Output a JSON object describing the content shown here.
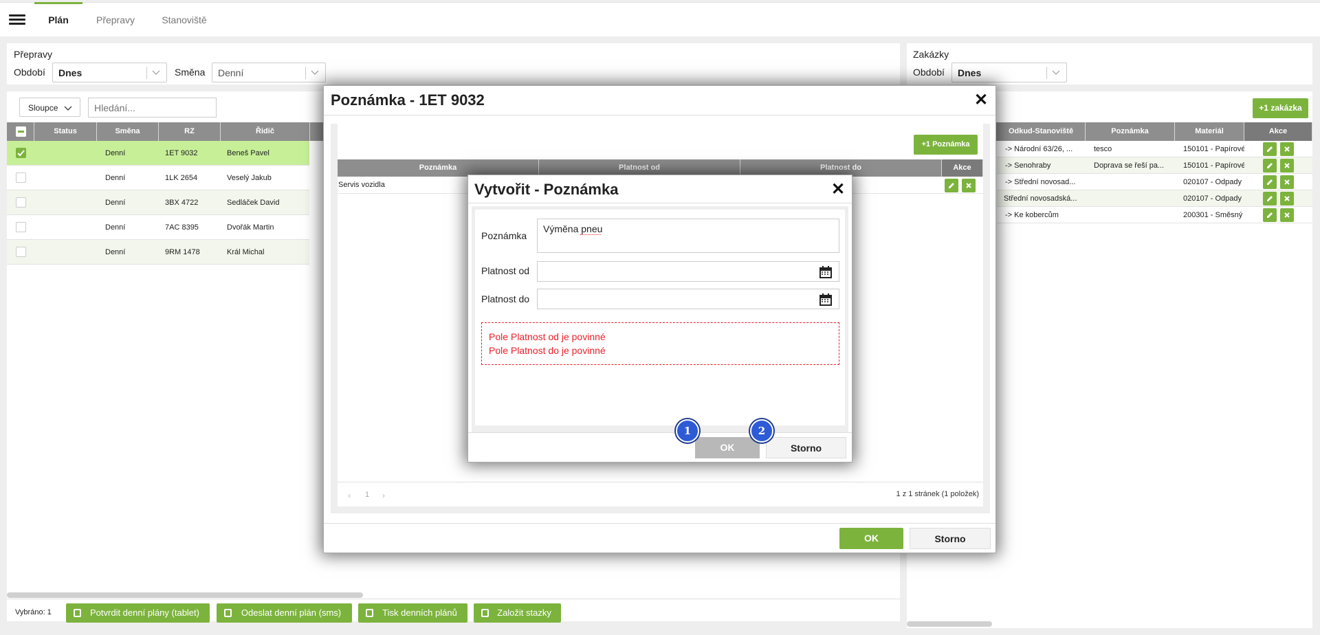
{
  "nav": {
    "tabs": [
      "Plán",
      "Přepravy",
      "Stanoviště"
    ]
  },
  "left_panel": {
    "title": "Přepravy",
    "obdobi_label": "Období",
    "obdobi_value": "Dnes",
    "smena_label": "Směna",
    "smena_value": "Denní",
    "columns_button": "Sloupce",
    "search_placeholder": "Hledání...",
    "headers": [
      "Status",
      "Směna",
      "RZ",
      "Řidič"
    ],
    "rows": [
      {
        "status": "",
        "smena": "Denní",
        "rz": "1ET 9032",
        "ridic": "Beneš Pavel",
        "checked": true
      },
      {
        "status": "",
        "smena": "Denní",
        "rz": "1LK 2654",
        "ridic": "Veselý Jakub",
        "checked": false
      },
      {
        "status": "",
        "smena": "Denní",
        "rz": "3BX 4722",
        "ridic": "Sedláček David",
        "checked": false
      },
      {
        "status": "",
        "smena": "Denní",
        "rz": "7AC 8395",
        "ridic": "Dvořák Martin",
        "checked": false
      },
      {
        "status": "",
        "smena": "Denní",
        "rz": "9RM 1478",
        "ridic": "Král Michal",
        "checked": false
      }
    ],
    "selected_label": "Vybráno: 1",
    "footer_buttons": [
      "Potvrdit denní plány (tablet)",
      "Odeslat denní plán (sms)",
      "Tisk denních plánů",
      "Založit stazky"
    ]
  },
  "right_panel": {
    "title": "Zakázky",
    "obdobi_label": "Období",
    "obdobi_value": "Dnes",
    "add_button": "+1 zakázka",
    "headers": [
      "Odkud-Stanoviště",
      "Poznámka",
      "Materiál",
      "Akce"
    ],
    "rows": [
      {
        "odkud": "-> Národní 63/26, ...",
        "poznamka": "tesco",
        "material": "150101 - Papírové"
      },
      {
        "odkud": "-> Senohraby",
        "poznamka": "Doprava se řeší pa...",
        "material": "150101 - Papírové"
      },
      {
        "odkud": "-> Střední novosad...",
        "poznamka": "",
        "material": "020107 - Odpady"
      },
      {
        "odkud": "Střední novosadská...",
        "poznamka": "",
        "material": "020107 - Odpady"
      },
      {
        "odkud": "-> Ke kobercům",
        "poznamka": "",
        "material": "200301 - Směsný"
      }
    ]
  },
  "note_dialog": {
    "title": "Poznámka - 1ET 9032",
    "add_button": "+1 Poznámka",
    "headers": [
      "Poznámka",
      "Platnost od",
      "Platnost do",
      "Akce"
    ],
    "rows": [
      {
        "poznamka": "Servis vozidla",
        "od": "",
        "do": ""
      }
    ],
    "pager_page": "1",
    "pager_info": "1 z 1 stránek (1 položek)",
    "ok": "OK",
    "cancel": "Storno"
  },
  "create_dialog": {
    "title": "Vytvořit - Poznámka",
    "poznamka_label": "Poznámka",
    "poznamka_value": "Výměna pneu",
    "od_label": "Platnost od",
    "do_label": "Platnost do",
    "errors": [
      "Pole Platnost od je povinné",
      "Pole Platnost do je povinné"
    ],
    "ok": "OK",
    "cancel": "Storno"
  },
  "markers": [
    "1",
    "2"
  ],
  "colors": {
    "accent": "#7cb33d",
    "error": "#e8202a",
    "marker": "#2d5bd6",
    "header": "#8e8e8e"
  }
}
